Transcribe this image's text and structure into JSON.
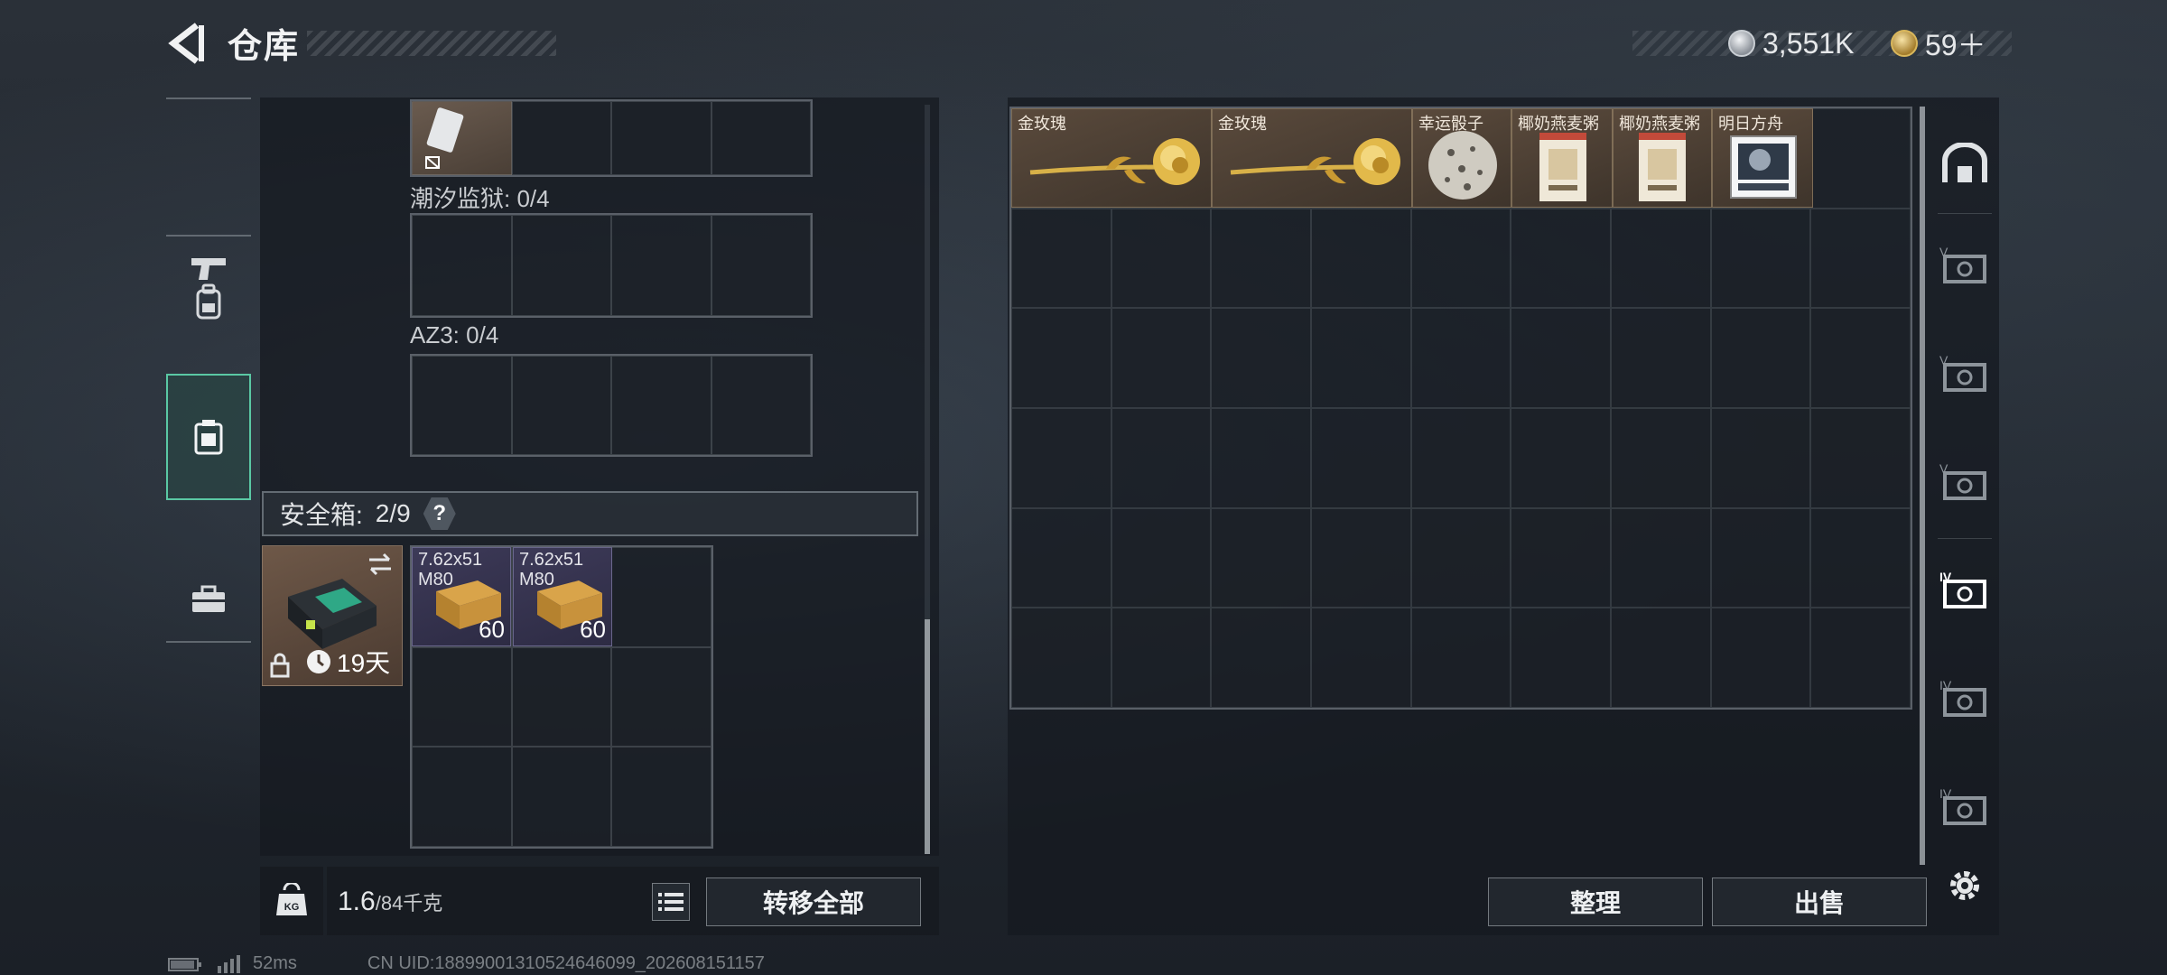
{
  "header": {
    "title": "仓库",
    "currencies": [
      {
        "icon": "silver-coin-icon",
        "value": "3,551K"
      },
      {
        "icon": "gold-triangle-coin-icon",
        "value": "59＋"
      }
    ]
  },
  "left_nav": {
    "items": [
      {
        "icon": "pistol-icon",
        "active": false
      },
      {
        "icon": "backpack-icon",
        "active": false
      },
      {
        "icon": "case-icon",
        "active": true
      },
      {
        "icon": "toolbox-icon",
        "active": false
      }
    ]
  },
  "containers": [
    {
      "label": "潮汐监狱: 0/4"
    },
    {
      "label": "AZ3: 0/4"
    }
  ],
  "safe_box": {
    "label": "安全箱:",
    "count": "2/9",
    "help": "?",
    "days": "19天",
    "items": [
      {
        "name": "7.62x51 M80",
        "count": "60"
      },
      {
        "name": "7.62x51 M80",
        "count": "60"
      }
    ]
  },
  "footer_left": {
    "weight_icon_text": "KG",
    "weight_value": "1.6",
    "weight_max": "/84千克",
    "transfer_all": "转移全部"
  },
  "stash": {
    "items": [
      {
        "name": "金玫瑰",
        "type": "rose"
      },
      {
        "name": "金玫瑰",
        "type": "rose"
      },
      {
        "name": "幸运骰子",
        "type": "dice"
      },
      {
        "name": "椰奶燕麦粥",
        "type": "package"
      },
      {
        "name": "椰奶燕麦粥",
        "type": "package"
      },
      {
        "name": "明日方舟",
        "type": "card"
      }
    ],
    "sort_button": "整理",
    "sell_button": "出售"
  },
  "right_nav": {
    "items": [
      {
        "icon": "stash-home-icon",
        "label": ""
      },
      {
        "icon": "expansion-case-icon",
        "label": "V"
      },
      {
        "icon": "expansion-case-icon",
        "label": "V"
      },
      {
        "icon": "expansion-case-icon",
        "label": "V"
      },
      {
        "icon": "expansion-case-icon",
        "label": "IV",
        "active": true
      },
      {
        "icon": "expansion-case-icon",
        "label": "IV"
      },
      {
        "icon": "expansion-case-icon",
        "label": "IV"
      },
      {
        "icon": "settings-gear-icon",
        "label": ""
      }
    ]
  },
  "status": {
    "ping": "52ms",
    "uid": "CN UID:18899001310524646099_202608151157"
  },
  "colors": {
    "accent_active": "#5ac8a4",
    "panel_bg": "#161a20",
    "item_gold": "#5a4a3c",
    "item_purple": "#3d3a58"
  }
}
